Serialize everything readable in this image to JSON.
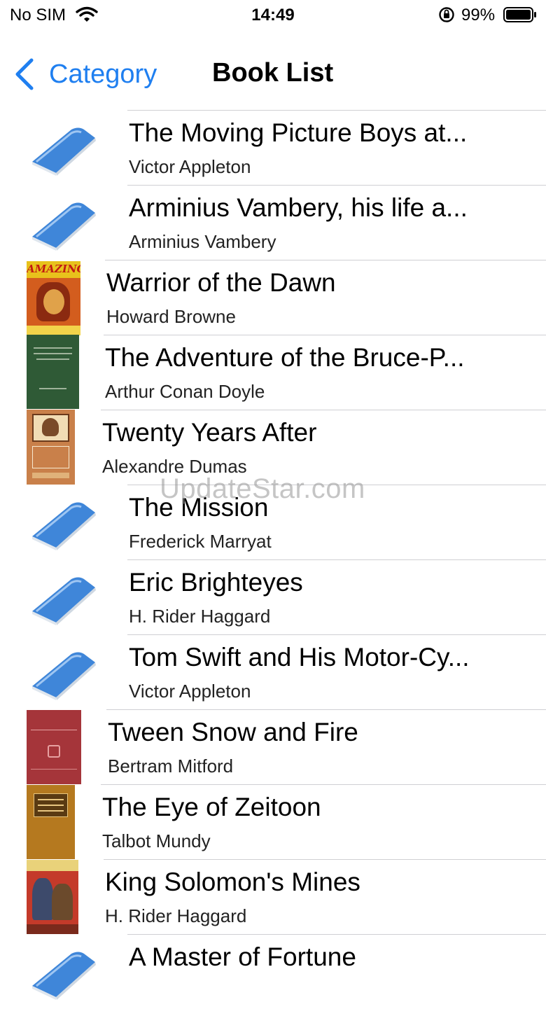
{
  "status_bar": {
    "carrier": "No SIM",
    "time": "14:49",
    "battery_percent": "99%"
  },
  "nav": {
    "back_label": "Category",
    "title": "Book List"
  },
  "watermark": "UpdateStar.com",
  "books": [
    {
      "title": "The Moving Picture Boys at...",
      "author": "Victor Appleton",
      "thumbnail": "generic-book-icon"
    },
    {
      "title": "Arminius Vambery, his life a...",
      "author": "Arminius Vambery",
      "thumbnail": "generic-book-icon"
    },
    {
      "title": "Warrior of the Dawn",
      "author": "Howard Browne",
      "thumbnail": "cover-amazing-stories"
    },
    {
      "title": "The Adventure of the Bruce-P...",
      "author": "Arthur Conan Doyle",
      "thumbnail": "cover-green-plain"
    },
    {
      "title": "Twenty Years After",
      "author": "Alexandre Dumas",
      "thumbnail": "cover-twenty-years-after"
    },
    {
      "title": "The Mission",
      "author": "Frederick Marryat",
      "thumbnail": "generic-book-icon"
    },
    {
      "title": "Eric Brighteyes",
      "author": "H. Rider Haggard",
      "thumbnail": "generic-book-icon"
    },
    {
      "title": "Tom Swift and His Motor-Cy...",
      "author": "Victor Appleton",
      "thumbnail": "generic-book-icon"
    },
    {
      "title": "Tween Snow and Fire",
      "author": "Bertram Mitford",
      "thumbnail": "cover-tween-snow-and-fire"
    },
    {
      "title": "The Eye of Zeitoon",
      "author": "Talbot Mundy",
      "thumbnail": "cover-eye-of-zeitoon"
    },
    {
      "title": "King Solomon's Mines",
      "author": "H. Rider Haggard",
      "thumbnail": "cover-king-solomons-mines"
    },
    {
      "title": "A Master of Fortune",
      "author": "",
      "thumbnail": "generic-book-icon"
    }
  ],
  "colors": {
    "accent": "#1f7ff0",
    "separator": "#cfcfd3",
    "book_icon_blue": "#3f86d9"
  }
}
